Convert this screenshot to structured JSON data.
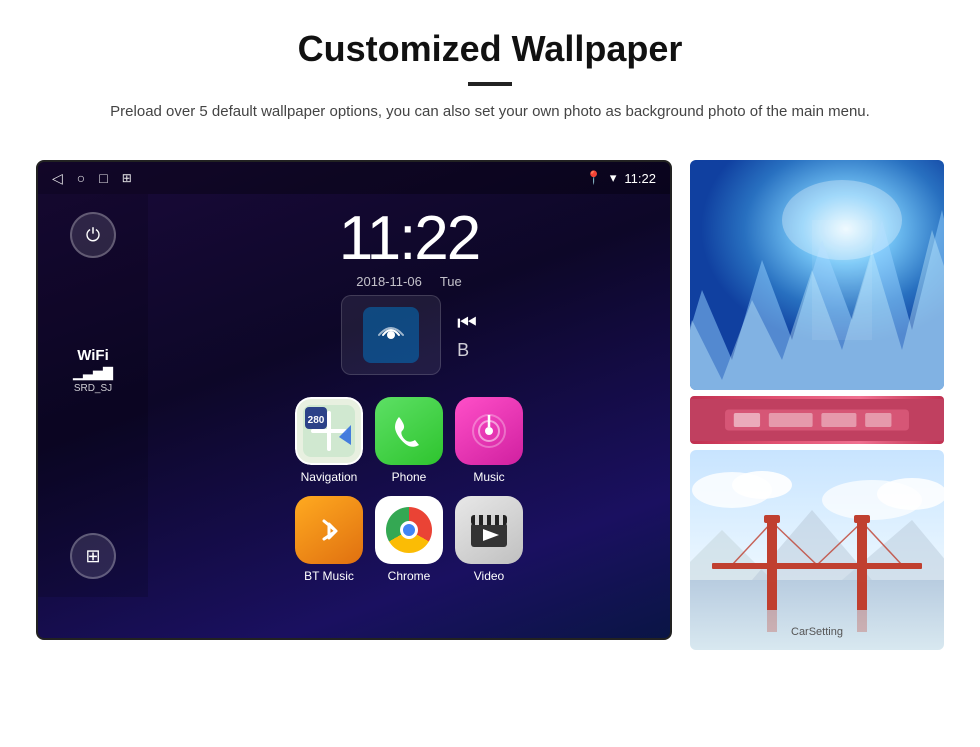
{
  "header": {
    "title": "Customized Wallpaper",
    "description": "Preload over 5 default wallpaper options, you can also set your own photo as background photo of the main menu."
  },
  "status_bar": {
    "time": "11:22",
    "icons": {
      "back": "◁",
      "home": "○",
      "recent": "□",
      "screenshot": "⊞",
      "location": "📍",
      "wifi": "▾",
      "time_label": "11:22"
    }
  },
  "clock": {
    "time": "11:22",
    "date": "2018-11-06",
    "day": "Tue"
  },
  "wifi": {
    "label": "WiFi",
    "ssid": "SRD_SJ"
  },
  "apps": [
    {
      "name": "Navigation",
      "icon_type": "nav"
    },
    {
      "name": "Phone",
      "icon_type": "phone"
    },
    {
      "name": "Music",
      "icon_type": "music"
    },
    {
      "name": "BT Music",
      "icon_type": "bt"
    },
    {
      "name": "Chrome",
      "icon_type": "chrome"
    },
    {
      "name": "Video",
      "icon_type": "video"
    }
  ]
}
